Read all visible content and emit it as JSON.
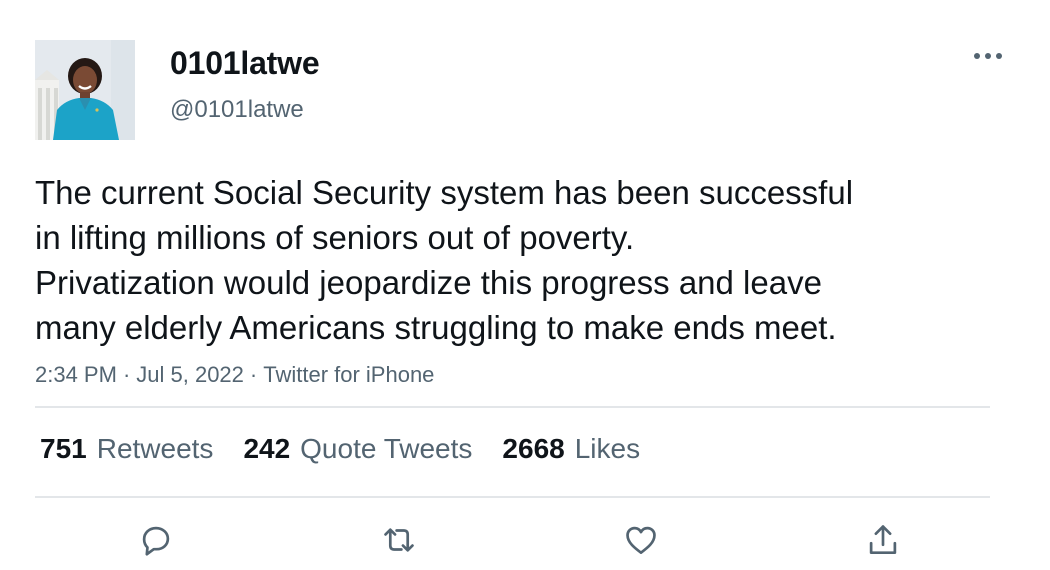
{
  "user": {
    "display_name": "0101latwe",
    "handle": "@0101latwe",
    "avatar_icon": "profile-photo-icon"
  },
  "menu": {
    "more_icon": "more-horizontal-icon"
  },
  "tweet": {
    "lines": [
      "The current Social Security system has been successful",
      "in lifting millions of seniors out of poverty.",
      "Privatization would jeopardize this progress and leave",
      "many elderly Americans struggling to make ends meet."
    ],
    "time": "2:34 PM",
    "date": "Jul 5, 2022",
    "source": "Twitter for iPhone"
  },
  "stats": {
    "retweets": {
      "count": "751",
      "label": "Retweets"
    },
    "quotes": {
      "count": "242",
      "label": "Quote Tweets"
    },
    "likes": {
      "count": "2668",
      "label": "Likes"
    }
  },
  "actions": {
    "reply_icon": "reply-icon",
    "retweet_icon": "retweet-icon",
    "like_icon": "heart-icon",
    "share_icon": "share-icon"
  },
  "colors": {
    "text_primary": "#0f1419",
    "text_secondary": "#536471",
    "icon": "#536471",
    "divider": "#e3e6e9",
    "avatar_jacket": "#1ca3c8"
  }
}
